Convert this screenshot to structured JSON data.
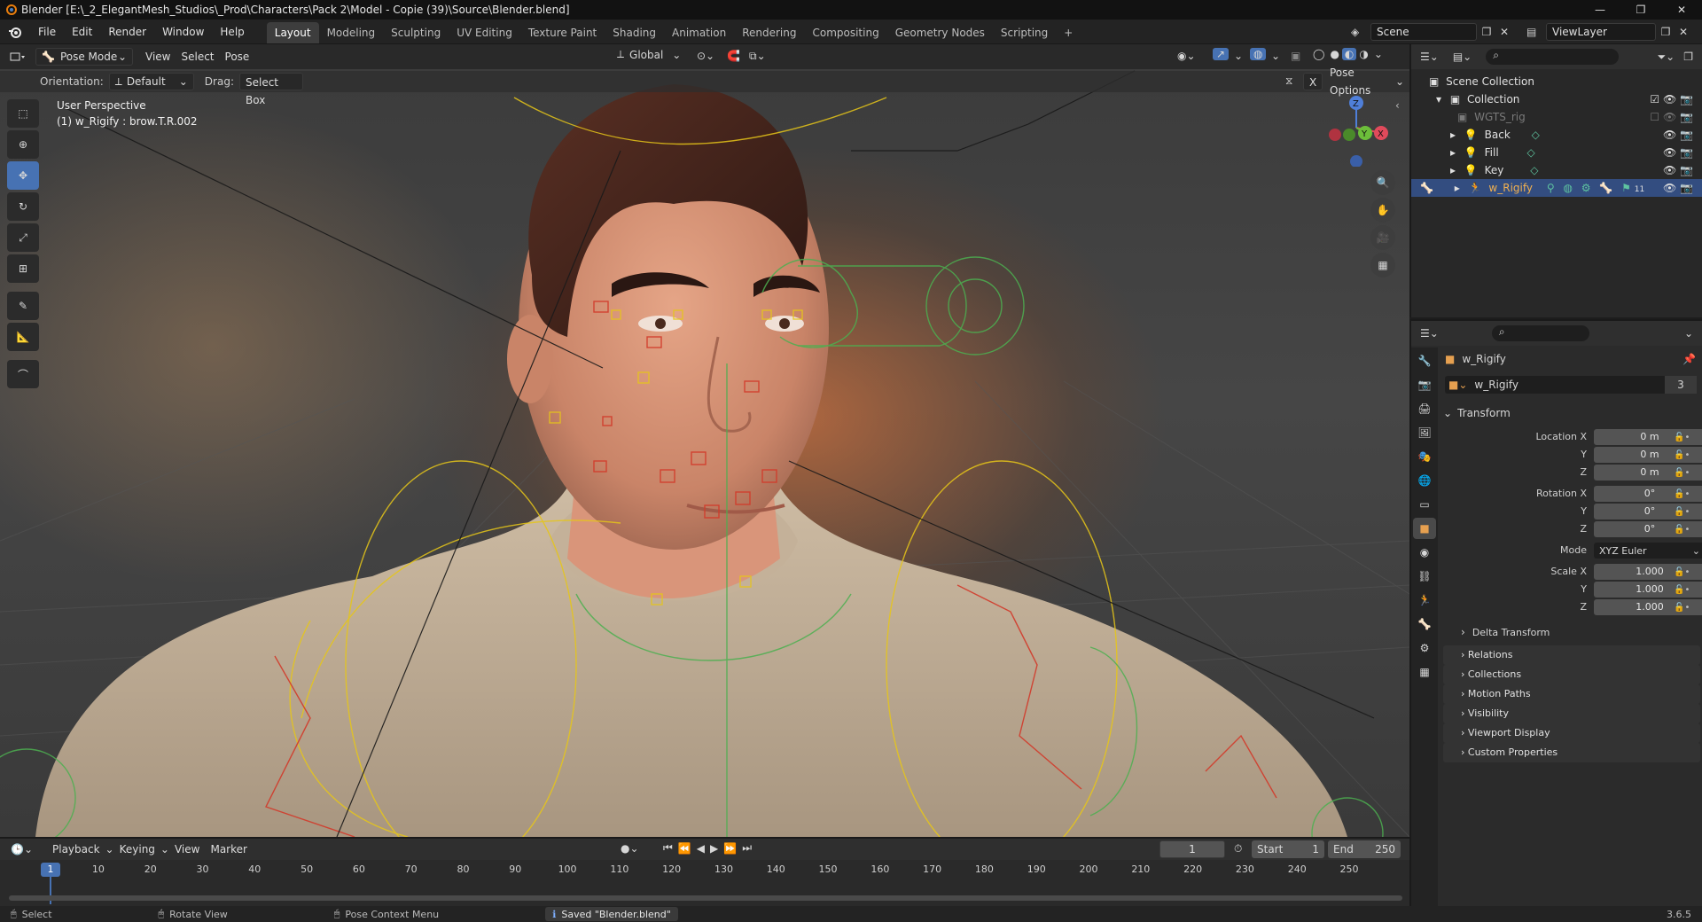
{
  "window": {
    "title": "Blender [E:\\_2_ElegantMesh_Studios\\_Prod\\Characters\\Pack 2\\Model - Copie (39)\\Source\\Blender.blend]",
    "controls": [
      "—",
      "❐",
      "✕"
    ]
  },
  "menu": [
    "File",
    "Edit",
    "Render",
    "Window",
    "Help"
  ],
  "workspaces": [
    "Layout",
    "Modeling",
    "Sculpting",
    "UV Editing",
    "Texture Paint",
    "Shading",
    "Animation",
    "Rendering",
    "Compositing",
    "Geometry Nodes",
    "Scripting"
  ],
  "active_workspace": "Layout",
  "add_tab": "+",
  "scene": {
    "name": "Scene",
    "view_layer": "ViewLayer"
  },
  "viewport": {
    "mode": "Pose Mode",
    "header_menus": [
      "View",
      "Select",
      "Pose"
    ],
    "transform_orientation": "Global",
    "orientation_label": "Orientation:",
    "orientation_value": "Default",
    "drag_label": "Drag:",
    "drag_value": "Select Box",
    "pose_options": "Pose Options",
    "x_mirror": "X",
    "overlay_line1": "User Perspective",
    "overlay_line2": "(1) w_Rigify : brow.T.R.002",
    "gizmo": {
      "z": "Z",
      "y": "Y",
      "x": "X"
    }
  },
  "outliner": {
    "root": "Scene Collection",
    "items": [
      {
        "name": "Collection",
        "level": 1
      },
      {
        "name": "WGTS_rig",
        "level": 2,
        "dim": true
      },
      {
        "name": "Back",
        "level": 2
      },
      {
        "name": "Fill",
        "level": 2
      },
      {
        "name": "Key",
        "level": 2
      },
      {
        "name": "w_Rigify",
        "level": 2,
        "selected": true
      }
    ],
    "rigify_count": "11"
  },
  "properties": {
    "object_name": "w_Rigify",
    "data_name": "w_Rigify",
    "users": "3",
    "transform_title": "Transform",
    "location_label": "Location X",
    "rotation_label": "Rotation X",
    "scale_label": "Scale X",
    "y_label": "Y",
    "z_label": "Z",
    "location": [
      "0 m",
      "0 m",
      "0 m"
    ],
    "rotation": [
      "0°",
      "0°",
      "0°"
    ],
    "mode_label": "Mode",
    "mode_value": "XYZ Euler",
    "scale": [
      "1.000",
      "1.000",
      "1.000"
    ],
    "delta_transform": "Delta Transform",
    "panels": [
      "Relations",
      "Collections",
      "Motion Paths",
      "Visibility",
      "Viewport Display",
      "Custom Properties"
    ]
  },
  "timeline": {
    "menus": [
      "Playback",
      "Keying",
      "View",
      "Marker"
    ],
    "current_frame": "1",
    "start_label": "Start",
    "start": "1",
    "end_label": "End",
    "end": "250",
    "ticks": [
      "1",
      "10",
      "20",
      "30",
      "40",
      "50",
      "60",
      "70",
      "80",
      "90",
      "100",
      "110",
      "120",
      "130",
      "140",
      "150",
      "160",
      "170",
      "180",
      "190",
      "200",
      "210",
      "220",
      "230",
      "240",
      "250"
    ]
  },
  "status": {
    "select": "Select",
    "rotate": "Rotate View",
    "context": "Pose Context Menu",
    "message": "Saved \"Blender.blend\"",
    "version": "3.6.5"
  },
  "colors": {
    "accent": "#4772b3",
    "selection": "#334d80",
    "bone_green": "#4caf50",
    "bone_yellow": "#e6c619",
    "bone_red": "#d23a2a"
  }
}
